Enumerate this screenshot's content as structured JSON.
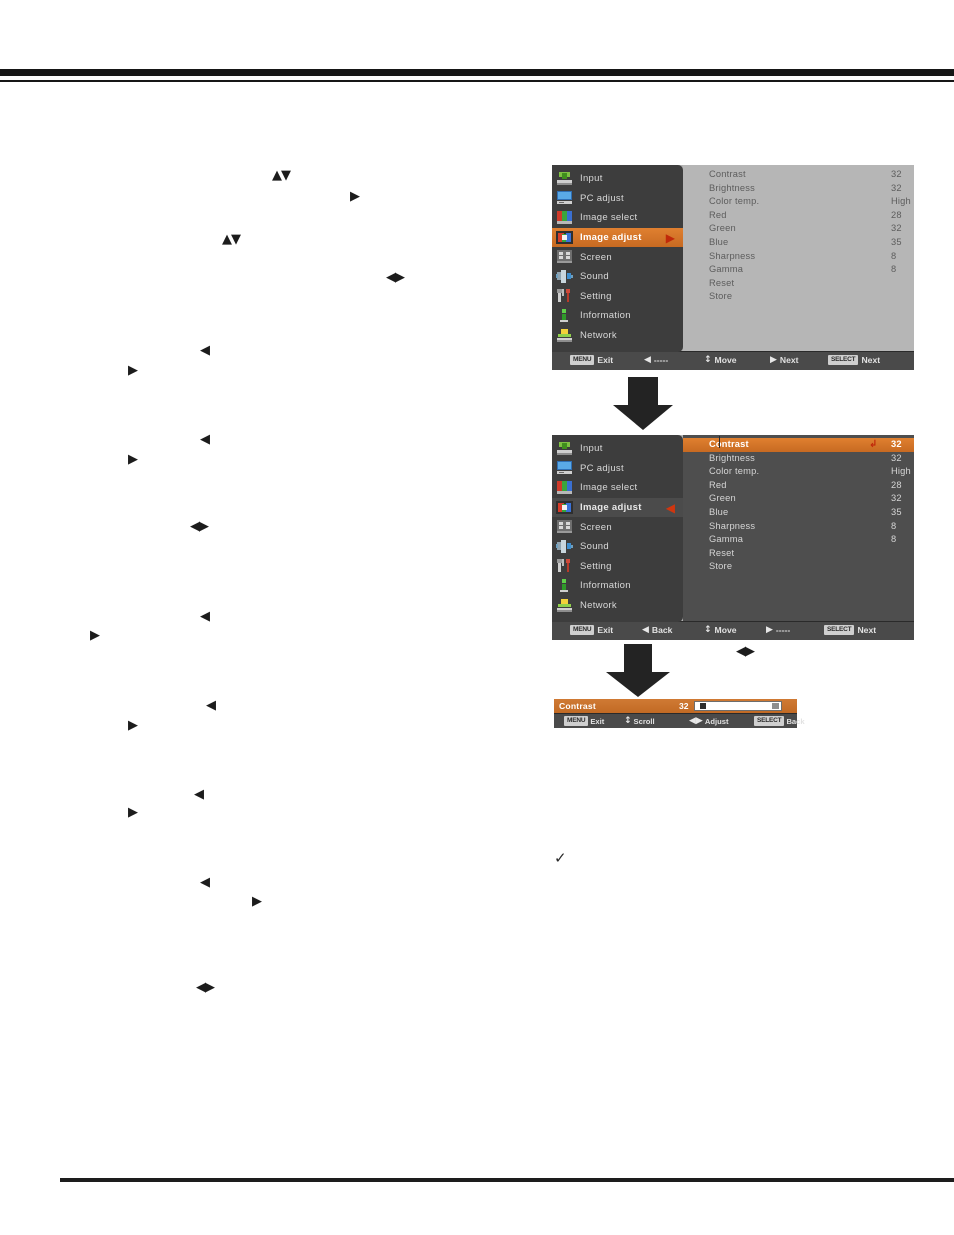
{
  "page": {
    "kind": "projector-manual-page",
    "background": "#ffffff",
    "rules": {
      "color": "#161616"
    }
  },
  "inline_glyphs": {
    "up_down": "▲▼",
    "right": "▶",
    "left": "◀",
    "left_right": "◀▶",
    "check": "✓"
  },
  "osd_menu_1": {
    "name": "Image adjust menu (top level)",
    "sidebar": {
      "items": [
        {
          "label": "Input",
          "icon": "input-icon",
          "state": "normal"
        },
        {
          "label": "PC adjust",
          "icon": "pc-adjust-icon",
          "state": "normal"
        },
        {
          "label": "Image select",
          "icon": "image-select-icon",
          "state": "normal"
        },
        {
          "label": "Image adjust",
          "icon": "image-adjust-icon",
          "state": "selected",
          "caret": "▶"
        },
        {
          "label": "Screen",
          "icon": "screen-icon",
          "state": "normal"
        },
        {
          "label": "Sound",
          "icon": "sound-icon",
          "state": "normal"
        },
        {
          "label": "Setting",
          "icon": "setting-icon",
          "state": "normal"
        },
        {
          "label": "Information",
          "icon": "information-icon",
          "state": "normal"
        },
        {
          "label": "Network",
          "icon": "network-icon",
          "state": "normal"
        }
      ],
      "highlight_color": "#d9801f"
    },
    "values": [
      {
        "label": "Contrast",
        "value": "32",
        "highlight": false
      },
      {
        "label": "Brightness",
        "value": "32",
        "highlight": false
      },
      {
        "label": "Color temp.",
        "value": "High",
        "highlight": false
      },
      {
        "label": "Red",
        "value": "28",
        "highlight": false
      },
      {
        "label": "Green",
        "value": "32",
        "highlight": false
      },
      {
        "label": "Blue",
        "value": "35",
        "highlight": false
      },
      {
        "label": "Sharpness",
        "value": "8",
        "highlight": false
      },
      {
        "label": "Gamma",
        "value": "8",
        "highlight": false
      },
      {
        "label": "Reset",
        "value": "",
        "highlight": false
      },
      {
        "label": "Store",
        "value": "",
        "highlight": false
      }
    ],
    "footer": [
      {
        "key": "MENU",
        "arrow": "",
        "label": "Exit"
      },
      {
        "key": "",
        "arrow": "◀",
        "label": "-----"
      },
      {
        "key": "",
        "arrow": "↕",
        "label": "Move"
      },
      {
        "key": "",
        "arrow": "▶",
        "label": "Next"
      },
      {
        "key": "SELECT",
        "arrow": "",
        "label": "Next"
      }
    ]
  },
  "osd_menu_2": {
    "name": "Image adjust menu (sub level, Contrast focused)",
    "sidebar": {
      "items": [
        {
          "label": "Input",
          "icon": "input-icon",
          "state": "normal"
        },
        {
          "label": "PC adjust",
          "icon": "pc-adjust-icon",
          "state": "normal"
        },
        {
          "label": "Image select",
          "icon": "image-select-icon",
          "state": "normal"
        },
        {
          "label": "Image adjust",
          "icon": "image-adjust-icon",
          "state": "active",
          "caret": "◀"
        },
        {
          "label": "Screen",
          "icon": "screen-icon",
          "state": "normal"
        },
        {
          "label": "Sound",
          "icon": "sound-icon",
          "state": "normal"
        },
        {
          "label": "Setting",
          "icon": "setting-icon",
          "state": "normal"
        },
        {
          "label": "Information",
          "icon": "information-icon",
          "state": "normal"
        },
        {
          "label": "Network",
          "icon": "network-icon",
          "state": "normal"
        }
      ]
    },
    "values": [
      {
        "label": "Contrast",
        "value": "32",
        "highlight": true,
        "enter": "↲"
      },
      {
        "label": "Brightness",
        "value": "32",
        "highlight": false
      },
      {
        "label": "Color temp.",
        "value": "High",
        "highlight": false
      },
      {
        "label": "Red",
        "value": "28",
        "highlight": false
      },
      {
        "label": "Green",
        "value": "32",
        "highlight": false
      },
      {
        "label": "Blue",
        "value": "35",
        "highlight": false
      },
      {
        "label": "Sharpness",
        "value": "8",
        "highlight": false
      },
      {
        "label": "Gamma",
        "value": "8",
        "highlight": false
      },
      {
        "label": "Reset",
        "value": "",
        "highlight": false
      },
      {
        "label": "Store",
        "value": "",
        "highlight": false
      }
    ],
    "footer": [
      {
        "key": "MENU",
        "arrow": "",
        "label": "Exit"
      },
      {
        "key": "",
        "arrow": "◀",
        "label": "Back"
      },
      {
        "key": "",
        "arrow": "↕",
        "label": "Move"
      },
      {
        "key": "",
        "arrow": "▶",
        "label": "-----"
      },
      {
        "key": "SELECT",
        "arrow": "",
        "label": "Next"
      }
    ]
  },
  "adjust_bar": {
    "name": "Contrast",
    "value": "32",
    "slider": {
      "min": 0,
      "max": 63,
      "current": 32,
      "fill_percent": 6
    },
    "footer": [
      {
        "key": "MENU",
        "arrow": "",
        "label": "Exit"
      },
      {
        "key": "",
        "arrow": "↕",
        "label": "Scroll"
      },
      {
        "key": "",
        "arrow": "◀▶",
        "label": "Adjust"
      },
      {
        "key": "SELECT",
        "arrow": "",
        "label": "Back"
      }
    ]
  },
  "colors": {
    "osd_orange": "#d9801f",
    "osd_sidebar": "#3d3d3d",
    "osd_pane_light": "#b6b6b6",
    "osd_pane_dark": "#4e4e4e",
    "osd_footer": "#4a4a4a",
    "caret_red": "#d0360f",
    "rule": "#161616"
  }
}
